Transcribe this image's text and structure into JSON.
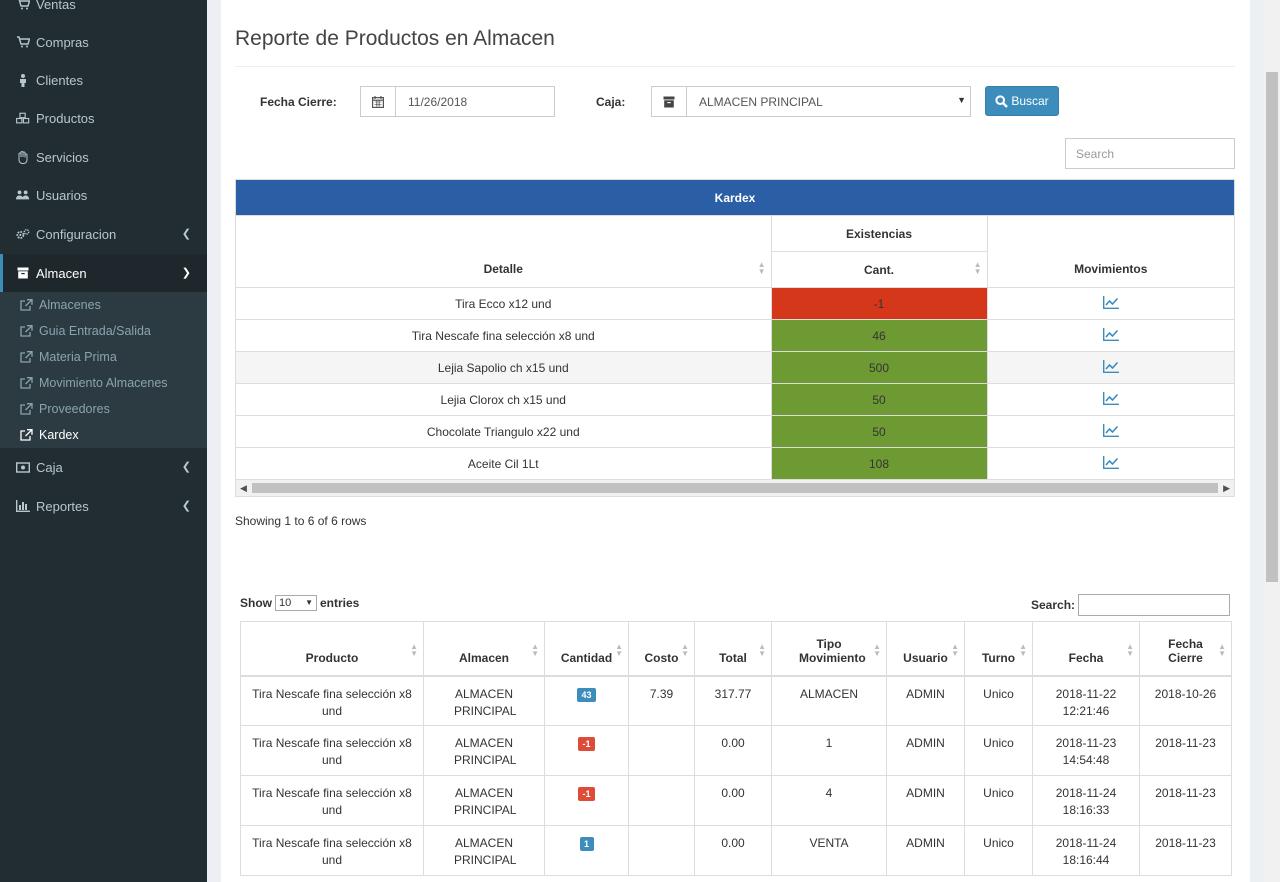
{
  "sidebar": {
    "items": [
      {
        "label": "Ventas"
      },
      {
        "label": "Compras"
      },
      {
        "label": "Clientes"
      },
      {
        "label": "Productos"
      },
      {
        "label": "Servicios"
      },
      {
        "label": "Usuarios"
      },
      {
        "label": "Configuracion"
      },
      {
        "label": "Almacen"
      },
      {
        "label": "Caja"
      },
      {
        "label": "Reportes"
      }
    ],
    "submenu": [
      {
        "label": "Almacenes"
      },
      {
        "label": "Guia Entrada/Salida"
      },
      {
        "label": "Materia Prima"
      },
      {
        "label": "Movimiento Almacenes"
      },
      {
        "label": "Proveedores"
      },
      {
        "label": "Kardex"
      }
    ]
  },
  "page": {
    "title": "Reporte de Productos en Almacen"
  },
  "filters": {
    "fecha_label": "Fecha Cierre:",
    "fecha_value": "11/26/2018",
    "caja_label": "Caja:",
    "caja_value": "ALMACEN PRINCIPAL",
    "buscar_label": "Buscar",
    "search_placeholder": "Search"
  },
  "kardex": {
    "title": "Kardex",
    "col_detalle": "Detalle",
    "col_existencias": "Existencias",
    "col_cant": "Cant.",
    "col_movimientos": "Movimientos",
    "rows": [
      {
        "detalle": "Tira Ecco x12 und",
        "cant": "-1",
        "status": "neg"
      },
      {
        "detalle": "Tira Nescafe fina selección x8 und",
        "cant": "46",
        "status": "pos"
      },
      {
        "detalle": "Lejia Sapolio ch x15 und",
        "cant": "500",
        "status": "pos"
      },
      {
        "detalle": "Lejia Clorox ch x15 und",
        "cant": "50",
        "status": "pos"
      },
      {
        "detalle": "Chocolate Triangulo x22 und",
        "cant": "50",
        "status": "pos"
      },
      {
        "detalle": "Aceite Cil 1Lt",
        "cant": "108",
        "status": "pos"
      }
    ],
    "showing": "Showing 1 to 6 of 6 rows"
  },
  "datatable": {
    "show_label": "Show",
    "entries_value": "10",
    "entries_label": "entries",
    "search_label": "Search:",
    "headers": [
      "Producto",
      "Almacen",
      "Cantidad",
      "Costo",
      "Total",
      "Tipo Movimiento",
      "Usuario",
      "Turno",
      "Fecha",
      "Fecha Cierre"
    ],
    "rows": [
      {
        "producto": "Tira Nescafe fina selección x8 und",
        "almacen": "ALMACEN PRINCIPAL",
        "cantidad": "43",
        "cantidad_color": "blue",
        "costo": "7.39",
        "total": "317.77",
        "tipo": "ALMACEN",
        "usuario": "ADMIN",
        "turno": "Unico",
        "fecha": "2018-11-22 12:21:46",
        "fecha_cierre": "2018-10-26"
      },
      {
        "producto": "Tira Nescafe fina selección x8 und",
        "almacen": "ALMACEN PRINCIPAL",
        "cantidad": "-1",
        "cantidad_color": "red",
        "costo": "",
        "total": "0.00",
        "tipo": "1",
        "usuario": "ADMIN",
        "turno": "Unico",
        "fecha": "2018-11-23 14:54:48",
        "fecha_cierre": "2018-11-23"
      },
      {
        "producto": "Tira Nescafe fina selección x8 und",
        "almacen": "ALMACEN PRINCIPAL",
        "cantidad": "-1",
        "cantidad_color": "red",
        "costo": "",
        "total": "0.00",
        "tipo": "4",
        "usuario": "ADMIN",
        "turno": "Unico",
        "fecha": "2018-11-24 18:16:33",
        "fecha_cierre": "2018-11-23"
      },
      {
        "producto": "Tira Nescafe fina selección x8 und",
        "almacen": "ALMACEN PRINCIPAL",
        "cantidad": "1",
        "cantidad_color": "blue",
        "costo": "",
        "total": "0.00",
        "tipo": "VENTA",
        "usuario": "ADMIN",
        "turno": "Unico",
        "fecha": "2018-11-24 18:16:44",
        "fecha_cierre": "2018-11-23"
      }
    ]
  },
  "colors": {
    "accent": "#3c8dbc",
    "kardex_header": "#2a5ea5",
    "negative": "#d43719",
    "positive": "#6e9a33",
    "sidebar": "#222d32"
  }
}
